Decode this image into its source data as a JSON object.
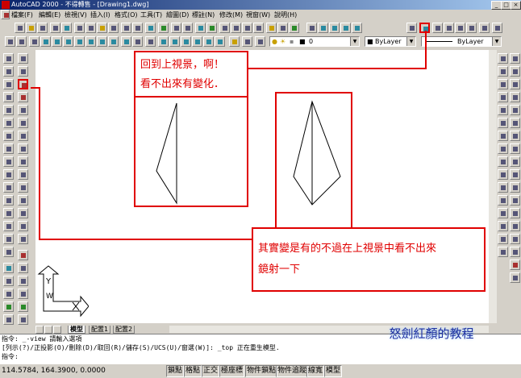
{
  "window": {
    "title": "AutoCAD 2000 - 不得轉售 - [Drawing1.dwg]",
    "buttons": [
      "_",
      "□",
      "×"
    ]
  },
  "menu": [
    "檔案(F)",
    "編輯(E)",
    "檢視(V)",
    "插入(I)",
    "格式(O)",
    "工具(T)",
    "繪圖(D)",
    "標註(N)",
    "修改(M)",
    "視窗(W)",
    "說明(H)"
  ],
  "properties": {
    "layer_value": "0",
    "color_value": "ByLayer",
    "linetype_value": "ByLayer"
  },
  "annotations": {
    "note1": [
      "回到上視景，啊！",
      "看不出來有變化．"
    ],
    "note2": [
      "其實變是有的不過在上視景中看不出來",
      "鏡射一下"
    ]
  },
  "ucs": {
    "y_label": "Y",
    "w_label": "W"
  },
  "tabs": [
    "模型",
    "配置1",
    "配置2"
  ],
  "command_line": [
    "指令:  _-view 請輸入選項",
    "[列示(?)/正投影(O)/刪除(D)/取回(R)/儲存(S)/UCS(U)/窗選(W)]: _top 正在重生模型.",
    "指令:"
  ],
  "status": {
    "coords": "114.5784, 164.3900, 0.0000",
    "toggles": [
      "鎖點",
      "格點",
      "正交",
      "極座標",
      "物件鎖點",
      "物件追蹤",
      "線寬",
      "模型"
    ]
  },
  "watermark": "怒劍紅顏的教程",
  "colors": {
    "annotation": "#e00000",
    "canvas": "#ffffff",
    "chrome": "#d4d0c8",
    "title_start": "#0a246a"
  },
  "icons": [
    "app-icon",
    "new-icon",
    "open-icon",
    "save-icon",
    "print-icon",
    "cut-icon",
    "copy-icon",
    "paste-icon",
    "undo-icon",
    "redo-icon",
    "line-icon",
    "mirror-icon",
    "view-top-icon",
    "layer-icon",
    "bulb-icon"
  ]
}
